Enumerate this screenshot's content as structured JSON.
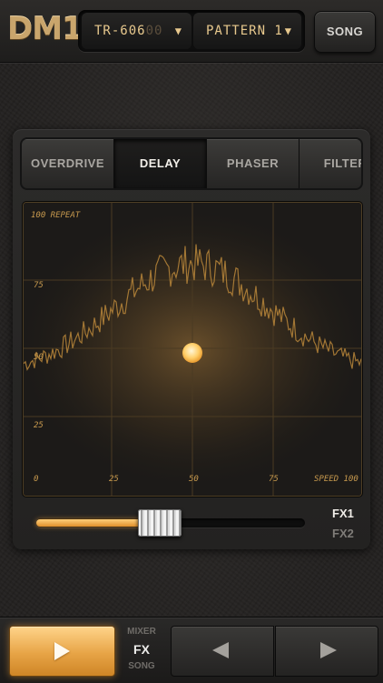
{
  "app": {
    "logo": "DM1"
  },
  "header": {
    "kit_label": "TR-606",
    "kit_ghost": "00",
    "pattern_label": "PATTERN 1",
    "song_label": "SONG",
    "dropdown_icon": "triangle-down-icon"
  },
  "fx_tabs": [
    {
      "label": "OVERDRIVE",
      "active": false
    },
    {
      "label": "DELAY",
      "active": true
    },
    {
      "label": "PHASER",
      "active": false
    },
    {
      "label": "FILTER",
      "active": false
    }
  ],
  "xy_pad": {
    "y_axis": {
      "title": "100 REPEAT",
      "ticks": [
        "75",
        "50",
        "25"
      ]
    },
    "x_axis": {
      "title": "SPEED 100",
      "ticks": [
        "0",
        "25",
        "50",
        "75"
      ]
    },
    "cursor": {
      "x": 50,
      "y": 50
    },
    "accent_color": "#ffb54a"
  },
  "fx_slider": {
    "value": 0.44
  },
  "fx_slots": {
    "fx1": "FX1",
    "fx2": "FX2",
    "active": "FX1"
  },
  "bottom": {
    "play_icon": "play-icon",
    "modes": {
      "mixer": "MIXER",
      "fx": "FX",
      "song": "SONG",
      "active": "FX"
    },
    "prev_icon": "prev-icon",
    "next_icon": "next-icon"
  }
}
